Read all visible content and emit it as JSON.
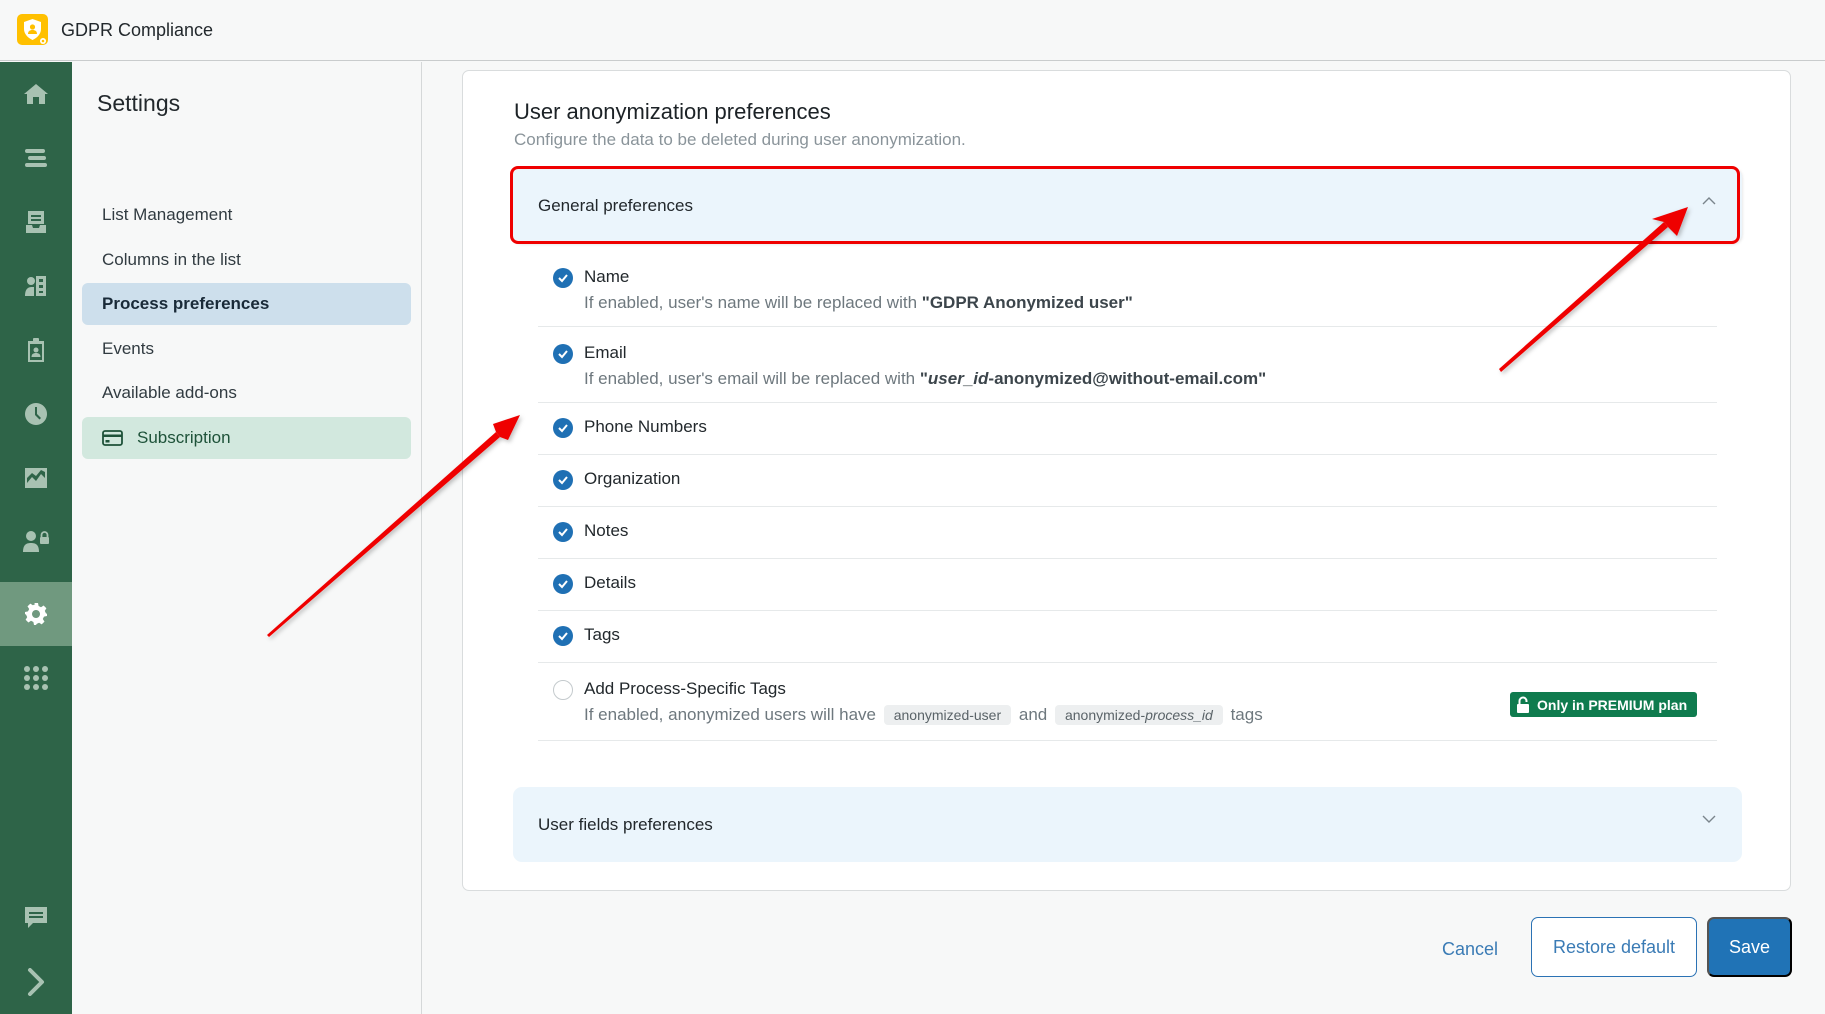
{
  "app": {
    "title": "GDPR Compliance",
    "logo_icon": "shield-user-icon",
    "brand_color": "#ffc000"
  },
  "rail": {
    "color": "#2e6448",
    "items": [
      {
        "name": "home",
        "icon": "home-icon",
        "active": false
      },
      {
        "name": "list",
        "icon": "list-icon",
        "active": false
      },
      {
        "name": "inbox",
        "icon": "inbox-icon",
        "active": false
      },
      {
        "name": "contacts",
        "icon": "contact-book-icon",
        "active": false
      },
      {
        "name": "clipboard",
        "icon": "clipboard-user-icon",
        "active": false
      },
      {
        "name": "history",
        "icon": "clock-icon",
        "active": false
      },
      {
        "name": "reports",
        "icon": "chart-icon",
        "active": false
      },
      {
        "name": "users-access",
        "icon": "user-lock-icon",
        "active": false
      },
      {
        "name": "settings",
        "icon": "gear-icon",
        "active": true
      },
      {
        "name": "apps",
        "icon": "grid-icon",
        "active": false
      },
      {
        "name": "feedback",
        "icon": "chat-icon",
        "active": false
      },
      {
        "name": "expand",
        "icon": "chevron-right-icon",
        "active": false
      }
    ]
  },
  "subnav": {
    "title": "Settings",
    "items": [
      {
        "label": "List Management",
        "active": false
      },
      {
        "label": "Columns in the list",
        "active": false
      },
      {
        "label": "Process preferences",
        "active": true
      },
      {
        "label": "Events",
        "active": false
      },
      {
        "label": "Available add-ons",
        "active": false
      },
      {
        "label": "Subscription",
        "icon": "credit-card-icon",
        "active": false
      }
    ]
  },
  "main": {
    "title": "User anonymization preferences",
    "subtitle": "Configure the data to be deleted during user anonymization.",
    "general": {
      "header": "General preferences",
      "expanded": true,
      "options": [
        {
          "label": "Name",
          "checked": true,
          "desc_prefix": "If enabled, user's name will be replaced with ",
          "desc_value": "\"GDPR Anonymized user\""
        },
        {
          "label": "Email",
          "checked": true,
          "desc_prefix": "If enabled, user's email will be replaced with ",
          "desc_quote_open": "\"",
          "desc_value_italic": "user_id",
          "desc_value_rest": "-anonymized@without-email.com\""
        },
        {
          "label": "Phone Numbers",
          "checked": true
        },
        {
          "label": "Organization",
          "checked": true
        },
        {
          "label": "Notes",
          "checked": true
        },
        {
          "label": "Details",
          "checked": true
        },
        {
          "label": "Tags",
          "checked": true
        },
        {
          "label": "Add Process-Specific Tags",
          "checked": false,
          "desc_prefix": "If enabled, anonymized users will have",
          "tag1": "anonymized-user",
          "desc_and": "and",
          "tag2_prefix": "anonymized-",
          "tag2_italic": "process_id",
          "desc_suffix": "tags",
          "badge": "Only in PREMIUM plan",
          "badge_color": "#0f7b4e"
        }
      ]
    },
    "user_fields": {
      "header": "User fields preferences",
      "expanded": false
    }
  },
  "actions": {
    "cancel": "Cancel",
    "restore": "Restore default",
    "save": "Save",
    "primary_color": "#2073b6"
  },
  "annotations": {
    "color": "#ef0000",
    "highlight": "General preferences header",
    "arrows": 2
  }
}
